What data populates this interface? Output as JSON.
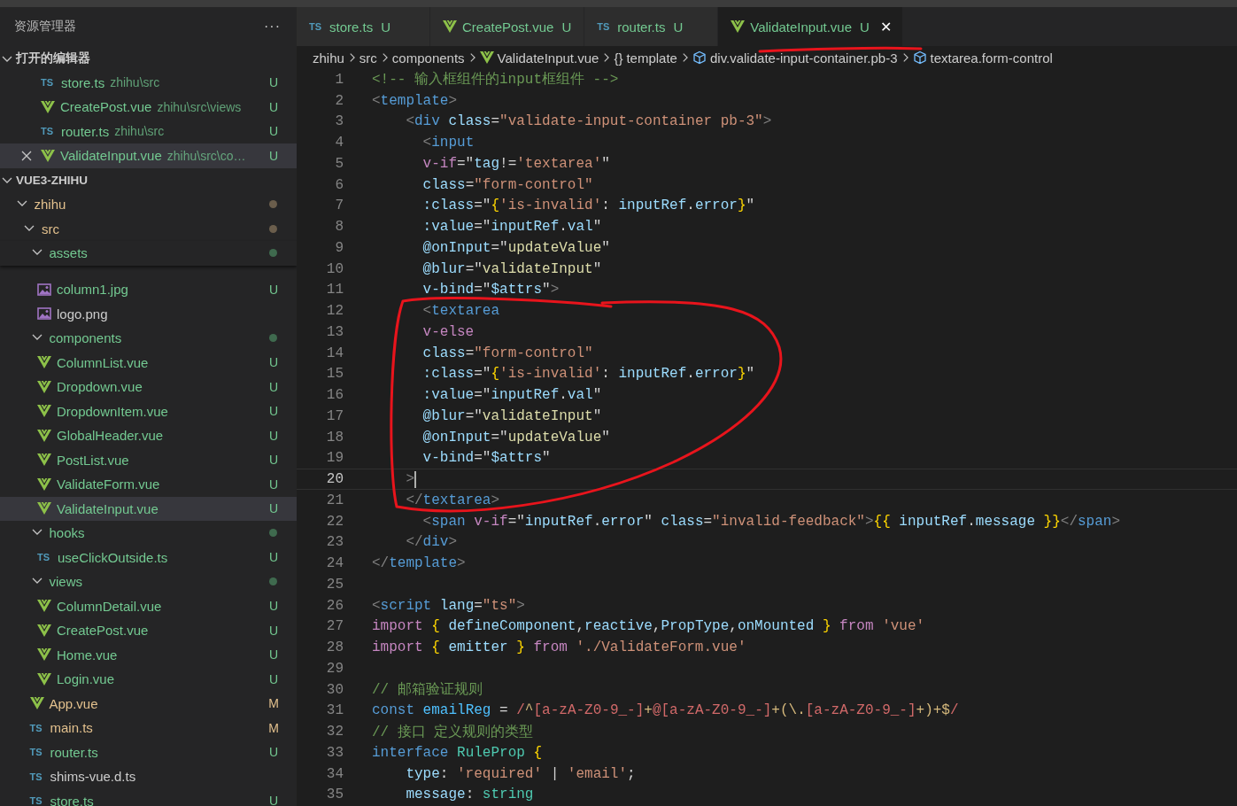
{
  "sidebar": {
    "title": "资源管理器",
    "more": "···",
    "open_editors": {
      "title": "打开的编辑器",
      "expanded": true,
      "items": [
        {
          "name": "store.ts",
          "path": "zhihu\\src",
          "kind": "ts",
          "icon_text": "TS",
          "color": "#73c991",
          "badge": "U",
          "selected": false
        },
        {
          "name": "CreatePost.vue",
          "path": "zhihu\\src\\views",
          "kind": "vue",
          "color": "#73c991",
          "badge": "U",
          "selected": false
        },
        {
          "name": "router.ts",
          "path": "zhihu\\src",
          "kind": "ts",
          "icon_text": "TS",
          "color": "#73c991",
          "badge": "U",
          "selected": false
        },
        {
          "name": "ValidateInput.vue",
          "path": "zhihu\\src\\co…",
          "kind": "vue",
          "color": "#73c991",
          "badge": "U",
          "selected": true
        }
      ]
    },
    "explorer": {
      "title": "VUE3-ZHIHU",
      "expanded": true,
      "tree": [
        {
          "name": "zhihu",
          "kind": "folder",
          "expanded": true,
          "color": "#e2c08d",
          "status_dot": {
            "color": "#6b5e4c"
          },
          "selected": false,
          "children": [
            {
              "name": "src",
              "kind": "folder",
              "expanded": true,
              "color": "#e2c08d",
              "status_dot": {
                "color": "#6b5e4c"
              },
              "selected": false,
              "children": [
                {
                  "name": "assets",
                  "kind": "folder",
                  "expanded": true,
                  "sticky": true,
                  "color": "#73c991",
                  "status_dot": {
                    "color": "#3f6a4e"
                  },
                  "selected": false,
                  "children": [
                    {
                      "name": "column1.jpg",
                      "kind": "image",
                      "color": "#73c991",
                      "badge": "U",
                      "selected": false
                    },
                    {
                      "name": "logo.png",
                      "kind": "image",
                      "color": "#cccccc",
                      "selected": false
                    }
                  ]
                },
                {
                  "name": "components",
                  "kind": "folder",
                  "expanded": true,
                  "color": "#73c991",
                  "status_dot": {
                    "color": "#3f6a4e"
                  },
                  "selected": false,
                  "children": [
                    {
                      "name": "ColumnList.vue",
                      "kind": "vue",
                      "color": "#73c991",
                      "badge": "U",
                      "selected": false
                    },
                    {
                      "name": "Dropdown.vue",
                      "kind": "vue",
                      "color": "#73c991",
                      "badge": "U",
                      "selected": false
                    },
                    {
                      "name": "DropdownItem.vue",
                      "kind": "vue",
                      "color": "#73c991",
                      "badge": "U",
                      "selected": false
                    },
                    {
                      "name": "GlobalHeader.vue",
                      "kind": "vue",
                      "color": "#73c991",
                      "badge": "U",
                      "selected": false
                    },
                    {
                      "name": "PostList.vue",
                      "kind": "vue",
                      "color": "#73c991",
                      "badge": "U",
                      "selected": false
                    },
                    {
                      "name": "ValidateForm.vue",
                      "kind": "vue",
                      "color": "#73c991",
                      "badge": "U",
                      "selected": false
                    },
                    {
                      "name": "ValidateInput.vue",
                      "kind": "vue",
                      "color": "#73c991",
                      "badge": "U",
                      "selected": true
                    }
                  ]
                },
                {
                  "name": "hooks",
                  "kind": "folder",
                  "expanded": true,
                  "color": "#73c991",
                  "status_dot": {
                    "color": "#3f6a4e"
                  },
                  "selected": false,
                  "children": [
                    {
                      "name": "useClickOutside.ts",
                      "kind": "ts",
                      "icon_text": "TS",
                      "color": "#73c991",
                      "badge": "U",
                      "selected": false
                    }
                  ]
                },
                {
                  "name": "views",
                  "kind": "folder",
                  "expanded": true,
                  "color": "#73c991",
                  "status_dot": {
                    "color": "#3f6a4e"
                  },
                  "selected": false,
                  "children": [
                    {
                      "name": "ColumnDetail.vue",
                      "kind": "vue",
                      "color": "#73c991",
                      "badge": "U",
                      "selected": false
                    },
                    {
                      "name": "CreatePost.vue",
                      "kind": "vue",
                      "color": "#73c991",
                      "badge": "U",
                      "selected": false
                    },
                    {
                      "name": "Home.vue",
                      "kind": "vue",
                      "color": "#73c991",
                      "badge": "U",
                      "selected": false
                    },
                    {
                      "name": "Login.vue",
                      "kind": "vue",
                      "color": "#73c991",
                      "badge": "U",
                      "selected": false
                    }
                  ]
                },
                {
                  "name": "App.vue",
                  "kind": "vue",
                  "color": "#e2c08d",
                  "badge": "M",
                  "selected": false
                },
                {
                  "name": "main.ts",
                  "kind": "ts",
                  "icon_text": "TS",
                  "color": "#e2c08d",
                  "badge": "M",
                  "selected": false
                },
                {
                  "name": "router.ts",
                  "kind": "ts",
                  "icon_text": "TS",
                  "color": "#73c991",
                  "badge": "U",
                  "selected": false
                },
                {
                  "name": "shims-vue.d.ts",
                  "kind": "ts",
                  "icon_text": "TS",
                  "color": "#cccccc",
                  "selected": false
                },
                {
                  "name": "store.ts",
                  "kind": "ts",
                  "icon_text": "TS",
                  "color": "#73c991",
                  "badge": "U",
                  "selected": false
                }
              ]
            }
          ]
        }
      ]
    }
  },
  "tabs": [
    {
      "label": "store.ts",
      "kind": "ts",
      "icon_text": "TS",
      "badge": "U",
      "selected": false
    },
    {
      "label": "CreatePost.vue",
      "kind": "vue",
      "badge": "U",
      "selected": false
    },
    {
      "label": "router.ts",
      "kind": "ts",
      "icon_text": "TS",
      "badge": "U",
      "selected": false
    },
    {
      "label": "ValidateInput.vue",
      "kind": "vue",
      "badge": "U",
      "close": "✕",
      "selected": true
    }
  ],
  "breadcrumb": [
    {
      "label": "zhihu",
      "kind": "folder"
    },
    {
      "label": "src",
      "kind": "folder"
    },
    {
      "label": "components",
      "kind": "folder"
    },
    {
      "label": "ValidateInput.vue",
      "kind": "vue"
    },
    {
      "label": "template",
      "kind": "braces",
      "icon_text": "{}"
    },
    {
      "label": "div.validate-input-container.pb-3",
      "kind": "element"
    },
    {
      "label": "textarea.form-control",
      "kind": "element"
    }
  ],
  "code": [
    {
      "number": "1",
      "tokens": [
        {
          "kind": "comment",
          "text": "<!-- 输入框组件的input框组件 -->"
        }
      ]
    },
    {
      "number": "2",
      "tokens": [
        {
          "kind": "punct",
          "text": "<"
        },
        {
          "kind": "tag",
          "text": "template"
        },
        {
          "kind": "punct",
          "text": ">"
        }
      ]
    },
    {
      "number": "3",
      "tokens": [
        {
          "kind": "punct",
          "text": "    <"
        },
        {
          "kind": "tag",
          "text": "div"
        },
        {
          "kind": "attr",
          "text": " class"
        },
        {
          "kind": "plain",
          "text": "="
        },
        {
          "kind": "string",
          "text": "\"validate-input-container pb-3\""
        },
        {
          "kind": "punct",
          "text": ">"
        }
      ]
    },
    {
      "number": "4",
      "tokens": [
        {
          "kind": "punct",
          "text": "      <"
        },
        {
          "kind": "tag",
          "text": "input"
        }
      ]
    },
    {
      "number": "5",
      "tokens": [
        {
          "kind": "control",
          "text": "      v-if"
        },
        {
          "kind": "plain",
          "text": "=\""
        },
        {
          "kind": "var",
          "text": "tag"
        },
        {
          "kind": "plain",
          "text": "!="
        },
        {
          "kind": "string",
          "text": "'textarea'"
        },
        {
          "kind": "plain",
          "text": "\""
        }
      ]
    },
    {
      "number": "6",
      "tokens": [
        {
          "kind": "attr",
          "text": "      class"
        },
        {
          "kind": "plain",
          "text": "="
        },
        {
          "kind": "string",
          "text": "\"form-control\""
        }
      ]
    },
    {
      "number": "7",
      "tokens": [
        {
          "kind": "attr",
          "text": "      :class"
        },
        {
          "kind": "plain",
          "text": "=\""
        },
        {
          "kind": "brace",
          "text": "{"
        },
        {
          "kind": "string",
          "text": "'is-invalid'"
        },
        {
          "kind": "plain",
          "text": ": "
        },
        {
          "kind": "var",
          "text": "inputRef"
        },
        {
          "kind": "plain",
          "text": "."
        },
        {
          "kind": "var",
          "text": "error"
        },
        {
          "kind": "brace",
          "text": "}"
        },
        {
          "kind": "plain",
          "text": "\""
        }
      ]
    },
    {
      "number": "8",
      "tokens": [
        {
          "kind": "attr",
          "text": "      :value"
        },
        {
          "kind": "plain",
          "text": "=\""
        },
        {
          "kind": "var",
          "text": "inputRef"
        },
        {
          "kind": "plain",
          "text": "."
        },
        {
          "kind": "var",
          "text": "val"
        },
        {
          "kind": "plain",
          "text": "\""
        }
      ]
    },
    {
      "number": "9",
      "tokens": [
        {
          "kind": "attr",
          "text": "      @onInput"
        },
        {
          "kind": "plain",
          "text": "=\""
        },
        {
          "kind": "func",
          "text": "updateValue"
        },
        {
          "kind": "plain",
          "text": "\""
        }
      ]
    },
    {
      "number": "10",
      "tokens": [
        {
          "kind": "attr",
          "text": "      @blur"
        },
        {
          "kind": "plain",
          "text": "=\""
        },
        {
          "kind": "func",
          "text": "validateInput"
        },
        {
          "kind": "plain",
          "text": "\""
        }
      ]
    },
    {
      "number": "11",
      "tokens": [
        {
          "kind": "attr",
          "text": "      v-bind"
        },
        {
          "kind": "plain",
          "text": "=\""
        },
        {
          "kind": "var",
          "text": "$attrs"
        },
        {
          "kind": "plain",
          "text": "\""
        },
        {
          "kind": "punct",
          "text": ">"
        }
      ]
    },
    {
      "number": "12",
      "tokens": [
        {
          "kind": "punct",
          "text": "      <"
        },
        {
          "kind": "tag",
          "text": "textarea"
        }
      ]
    },
    {
      "number": "13",
      "tokens": [
        {
          "kind": "control",
          "text": "      v-else"
        }
      ]
    },
    {
      "number": "14",
      "tokens": [
        {
          "kind": "attr",
          "text": "      class"
        },
        {
          "kind": "plain",
          "text": "="
        },
        {
          "kind": "string",
          "text": "\"form-control\""
        }
      ]
    },
    {
      "number": "15",
      "tokens": [
        {
          "kind": "attr",
          "text": "      :class"
        },
        {
          "kind": "plain",
          "text": "=\""
        },
        {
          "kind": "brace",
          "text": "{"
        },
        {
          "kind": "string",
          "text": "'is-invalid'"
        },
        {
          "kind": "plain",
          "text": ": "
        },
        {
          "kind": "var",
          "text": "inputRef"
        },
        {
          "kind": "plain",
          "text": "."
        },
        {
          "kind": "var",
          "text": "error"
        },
        {
          "kind": "brace",
          "text": "}"
        },
        {
          "kind": "plain",
          "text": "\""
        }
      ]
    },
    {
      "number": "16",
      "tokens": [
        {
          "kind": "attr",
          "text": "      :value"
        },
        {
          "kind": "plain",
          "text": "=\""
        },
        {
          "kind": "var",
          "text": "inputRef"
        },
        {
          "kind": "plain",
          "text": "."
        },
        {
          "kind": "var",
          "text": "val"
        },
        {
          "kind": "plain",
          "text": "\""
        }
      ]
    },
    {
      "number": "17",
      "tokens": [
        {
          "kind": "attr",
          "text": "      @blur"
        },
        {
          "kind": "plain",
          "text": "=\""
        },
        {
          "kind": "func",
          "text": "validateInput"
        },
        {
          "kind": "plain",
          "text": "\""
        }
      ]
    },
    {
      "number": "18",
      "tokens": [
        {
          "kind": "attr",
          "text": "      @onInput"
        },
        {
          "kind": "plain",
          "text": "=\""
        },
        {
          "kind": "func",
          "text": "updateValue"
        },
        {
          "kind": "plain",
          "text": "\""
        }
      ]
    },
    {
      "number": "19",
      "tokens": [
        {
          "kind": "attr",
          "text": "      v-bind"
        },
        {
          "kind": "plain",
          "text": "=\""
        },
        {
          "kind": "var",
          "text": "$attrs"
        },
        {
          "kind": "plain",
          "text": "\""
        }
      ]
    },
    {
      "number": "20",
      "current": true,
      "tokens": [
        {
          "kind": "punct",
          "text": "    >"
        }
      ]
    },
    {
      "number": "21",
      "tokens": [
        {
          "kind": "punct",
          "text": "    </"
        },
        {
          "kind": "tag",
          "text": "textarea"
        },
        {
          "kind": "punct",
          "text": ">"
        }
      ]
    },
    {
      "number": "22",
      "tokens": [
        {
          "kind": "punct",
          "text": "      <"
        },
        {
          "kind": "tag",
          "text": "span"
        },
        {
          "kind": "control",
          "text": " v-if"
        },
        {
          "kind": "plain",
          "text": "=\""
        },
        {
          "kind": "var",
          "text": "inputRef"
        },
        {
          "kind": "plain",
          "text": "."
        },
        {
          "kind": "var",
          "text": "error"
        },
        {
          "kind": "plain",
          "text": "\" "
        },
        {
          "kind": "attr",
          "text": "class"
        },
        {
          "kind": "plain",
          "text": "="
        },
        {
          "kind": "string",
          "text": "\"invalid-feedback\""
        },
        {
          "kind": "punct",
          "text": ">"
        },
        {
          "kind": "brace",
          "text": "{{"
        },
        {
          "kind": "var",
          "text": " inputRef"
        },
        {
          "kind": "plain",
          "text": "."
        },
        {
          "kind": "var",
          "text": "message"
        },
        {
          "kind": "brace",
          "text": " }}"
        },
        {
          "kind": "punct",
          "text": "</"
        },
        {
          "kind": "tag",
          "text": "span"
        },
        {
          "kind": "punct",
          "text": ">"
        }
      ]
    },
    {
      "number": "23",
      "tokens": [
        {
          "kind": "punct",
          "text": "    </"
        },
        {
          "kind": "tag",
          "text": "div"
        },
        {
          "kind": "punct",
          "text": ">"
        }
      ]
    },
    {
      "number": "24",
      "tokens": [
        {
          "kind": "punct",
          "text": "</"
        },
        {
          "kind": "tag",
          "text": "template"
        },
        {
          "kind": "punct",
          "text": ">"
        }
      ]
    },
    {
      "number": "25"
    },
    {
      "number": "26",
      "tokens": [
        {
          "kind": "punct",
          "text": "<"
        },
        {
          "kind": "tag",
          "text": "script"
        },
        {
          "kind": "attr",
          "text": " lang"
        },
        {
          "kind": "plain",
          "text": "="
        },
        {
          "kind": "string",
          "text": "\"ts\""
        },
        {
          "kind": "punct",
          "text": ">"
        }
      ]
    },
    {
      "number": "27",
      "tokens": [
        {
          "kind": "control",
          "text": "import"
        },
        {
          "kind": "brace",
          "text": " {"
        },
        {
          "kind": "var",
          "text": " defineComponent"
        },
        {
          "kind": "plain",
          "text": ","
        },
        {
          "kind": "var",
          "text": "reactive"
        },
        {
          "kind": "plain",
          "text": ","
        },
        {
          "kind": "var",
          "text": "PropType"
        },
        {
          "kind": "plain",
          "text": ","
        },
        {
          "kind": "var",
          "text": "onMounted"
        },
        {
          "kind": "brace",
          "text": " }"
        },
        {
          "kind": "control",
          "text": " from"
        },
        {
          "kind": "string",
          "text": " 'vue'"
        }
      ]
    },
    {
      "number": "28",
      "tokens": [
        {
          "kind": "control",
          "text": "import"
        },
        {
          "kind": "brace",
          "text": " {"
        },
        {
          "kind": "var",
          "text": " emitter"
        },
        {
          "kind": "brace",
          "text": " }"
        },
        {
          "kind": "control",
          "text": " from"
        },
        {
          "kind": "string",
          "text": " './ValidateForm.vue'"
        }
      ]
    },
    {
      "number": "29"
    },
    {
      "number": "30",
      "tokens": [
        {
          "kind": "comment",
          "text": "// 邮箱验证规则"
        }
      ]
    },
    {
      "number": "31",
      "tokens": [
        {
          "kind": "keyword",
          "text": "const"
        },
        {
          "kind": "const",
          "text": " emailReg"
        },
        {
          "kind": "plain",
          "text": " = "
        },
        {
          "kind": "regex",
          "text": "/"
        },
        {
          "kind": "regexop",
          "text": "^"
        },
        {
          "kind": "regex",
          "text": "[a-zA-Z0-9_-]"
        },
        {
          "kind": "regexop",
          "text": "+"
        },
        {
          "kind": "regex",
          "text": "@[a-zA-Z0-9_-]"
        },
        {
          "kind": "regexop",
          "text": "+(\\."
        },
        {
          "kind": "regex",
          "text": "[a-zA-Z0-9_-]"
        },
        {
          "kind": "regexop",
          "text": "+)+$"
        },
        {
          "kind": "regex",
          "text": "/"
        }
      ]
    },
    {
      "number": "32",
      "tokens": [
        {
          "kind": "comment",
          "text": "// 接口 定义规则的类型"
        }
      ]
    },
    {
      "number": "33",
      "tokens": [
        {
          "kind": "keyword",
          "text": "interface"
        },
        {
          "kind": "type",
          "text": " RuleProp"
        },
        {
          "kind": "brace",
          "text": " {"
        }
      ]
    },
    {
      "number": "34",
      "tokens": [
        {
          "kind": "var",
          "text": "    type"
        },
        {
          "kind": "plain",
          "text": ": "
        },
        {
          "kind": "string",
          "text": "'required'"
        },
        {
          "kind": "plain",
          "text": " | "
        },
        {
          "kind": "string",
          "text": "'email'"
        },
        {
          "kind": "plain",
          "text": ";"
        }
      ]
    },
    {
      "number": "35",
      "tokens": [
        {
          "kind": "var",
          "text": "    message"
        },
        {
          "kind": "plain",
          "text": ": "
        },
        {
          "kind": "type",
          "text": "string"
        }
      ]
    }
  ]
}
